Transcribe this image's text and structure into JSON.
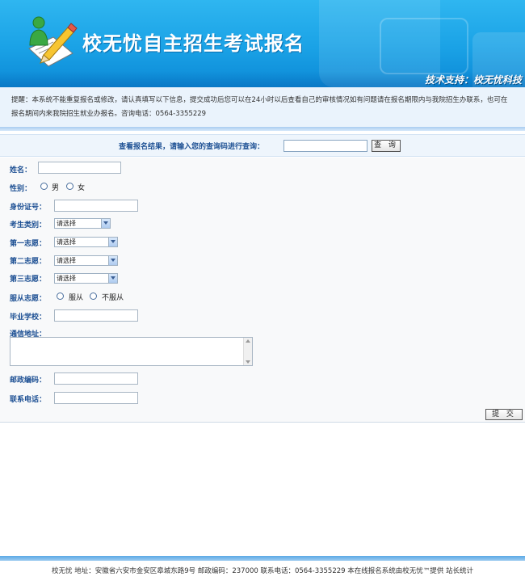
{
  "header": {
    "title": "校无忧自主招生考试报名",
    "support": "技术支持：校无忧科技"
  },
  "notice": {
    "text": "提醒：本系统不能重复报名或修改，请认真填写以下信息，提交成功后您可以在24小时以后查看自己的审核情况如有问题请在报名期限内与我院招生办联系，也可在报名期间内来我院招生就业办报名。咨询电话：0564-3355229"
  },
  "query": {
    "label": "查看报名结果，请输入您的查询码进行查询：",
    "input_value": "",
    "button_label": "查 询"
  },
  "form": {
    "name_label": "姓名：",
    "name_value": "",
    "gender_label": "性别：",
    "gender_options": [
      "男",
      "女"
    ],
    "id_label": "身份证号：",
    "id_value": "",
    "category_label": "考生类别：",
    "category_selected": "请选择",
    "choice1_label": "第一志愿：",
    "choice1_selected": "请选择",
    "choice2_label": "第二志愿：",
    "choice2_selected": "请选择",
    "choice3_label": "第三志愿：",
    "choice3_selected": "请选择",
    "obey_label": "服从志愿：",
    "obey_options": [
      "服从",
      "不服从"
    ],
    "school_label": "毕业学校：",
    "school_value": "",
    "address_label": "通信地址：",
    "address_value": "",
    "postcode_label": "邮政编码：",
    "postcode_value": "",
    "phone_label": "联系电话：",
    "phone_value": "",
    "submit_label": "提 交"
  },
  "footer": {
    "text": "校无忧  地址：安徽省六安市金安区皋城东路9号  邮政编码：237000  联系电话：0564-3355229  本在线报名系统由校无忧™提供  站长统计"
  },
  "colors": {
    "banner": "#1aa2e6",
    "label": "#1c4f93",
    "notice_bg": "#eaf3fc"
  }
}
